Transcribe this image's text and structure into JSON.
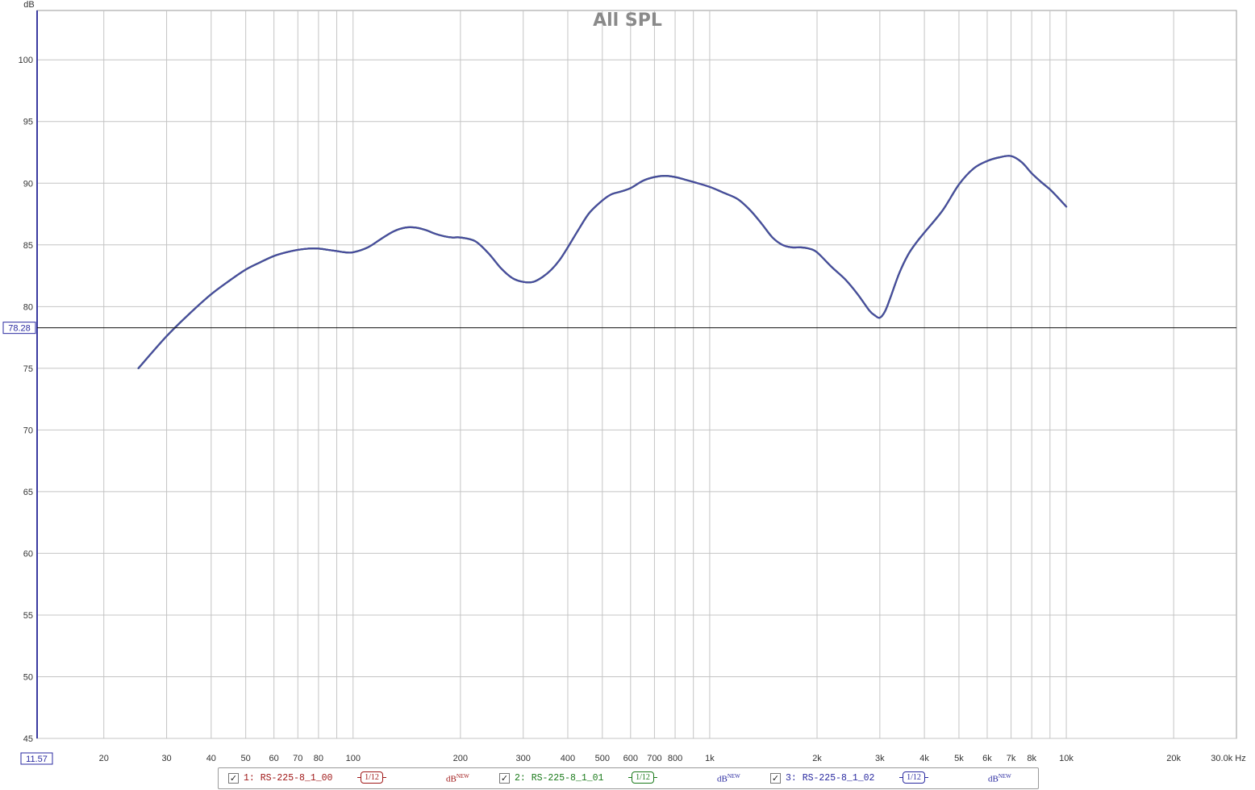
{
  "chart_data": {
    "type": "line",
    "title": "All SPL",
    "ylabel": "dB",
    "xunit": "Hz",
    "xscale": "log",
    "xlim": [
      13,
      30000
    ],
    "ylim": [
      45,
      104
    ],
    "grid": true,
    "x_ticks": [
      {
        "v": 20,
        "label": "20"
      },
      {
        "v": 30,
        "label": "30"
      },
      {
        "v": 40,
        "label": "40"
      },
      {
        "v": 50,
        "label": "50"
      },
      {
        "v": 60,
        "label": "60"
      },
      {
        "v": 70,
        "label": "70"
      },
      {
        "v": 80,
        "label": "80"
      },
      {
        "v": 100,
        "label": "100"
      },
      {
        "v": 200,
        "label": "200"
      },
      {
        "v": 300,
        "label": "300"
      },
      {
        "v": 400,
        "label": "400"
      },
      {
        "v": 500,
        "label": "500"
      },
      {
        "v": 600,
        "label": "600"
      },
      {
        "v": 700,
        "label": "700"
      },
      {
        "v": 800,
        "label": "800"
      },
      {
        "v": 1000,
        "label": "1k"
      },
      {
        "v": 2000,
        "label": "2k"
      },
      {
        "v": 3000,
        "label": "3k"
      },
      {
        "v": 4000,
        "label": "4k"
      },
      {
        "v": 5000,
        "label": "5k"
      },
      {
        "v": 6000,
        "label": "6k"
      },
      {
        "v": 7000,
        "label": "7k"
      },
      {
        "v": 8000,
        "label": "8k"
      },
      {
        "v": 10000,
        "label": "10k"
      },
      {
        "v": 20000,
        "label": "20k"
      },
      {
        "v": 30000,
        "label": "30.0k Hz"
      }
    ],
    "x_minor_grid": [
      90,
      900,
      9000
    ],
    "y_ticks": [
      45,
      50,
      55,
      60,
      65,
      70,
      75,
      80,
      85,
      90,
      95,
      100
    ],
    "cursor": {
      "y_value": "78.28",
      "x_value": "11.57"
    },
    "series": [
      {
        "name": "1: RS-225-8_1_00",
        "color": "#333377",
        "x": [
          25,
          30,
          35,
          40,
          45,
          50,
          55,
          60,
          65,
          70,
          75,
          80,
          85,
          90,
          95,
          100,
          110,
          120,
          130,
          140,
          150,
          160,
          170,
          180,
          190,
          200,
          220,
          240,
          260,
          280,
          300,
          320,
          340,
          360,
          380,
          400,
          430,
          460,
          500,
          530,
          560,
          600,
          650,
          700,
          750,
          800,
          850,
          900,
          1000,
          1100,
          1200,
          1300,
          1400,
          1500,
          1600,
          1700,
          1800,
          1900,
          2000,
          2200,
          2400,
          2600,
          2800,
          2900,
          3000,
          3100,
          3200,
          3400,
          3600,
          3800,
          4000,
          4500,
          5000,
          5500,
          6000,
          6500,
          7000,
          7500,
          8000,
          8500,
          9000,
          9500,
          10000
        ],
        "y": [
          75.0,
          77.6,
          79.5,
          81.0,
          82.1,
          83.0,
          83.6,
          84.1,
          84.4,
          84.6,
          84.7,
          84.7,
          84.6,
          84.5,
          84.4,
          84.4,
          84.8,
          85.5,
          86.1,
          86.4,
          86.4,
          86.2,
          85.9,
          85.7,
          85.6,
          85.6,
          85.3,
          84.3,
          83.1,
          82.3,
          82.0,
          82.0,
          82.4,
          83.0,
          83.8,
          84.8,
          86.3,
          87.6,
          88.6,
          89.1,
          89.3,
          89.6,
          90.2,
          90.5,
          90.6,
          90.5,
          90.3,
          90.1,
          89.7,
          89.2,
          88.7,
          87.8,
          86.7,
          85.6,
          85.0,
          84.8,
          84.8,
          84.7,
          84.4,
          83.2,
          82.2,
          81.0,
          79.7,
          79.3,
          79.1,
          79.6,
          80.6,
          82.7,
          84.2,
          85.2,
          86.0,
          87.8,
          89.9,
          91.2,
          91.8,
          92.1,
          92.2,
          91.7,
          90.8,
          90.1,
          89.5,
          88.8,
          88.1
        ]
      },
      {
        "name": "2: RS-225-8_1_01",
        "color": "#2a7a5a",
        "x": [
          25,
          30,
          35,
          40,
          45,
          50,
          55,
          60,
          65,
          70,
          75,
          80,
          85,
          90,
          95,
          100,
          110,
          120,
          130,
          140,
          150,
          160,
          170,
          180,
          190,
          200,
          220,
          240,
          260,
          280,
          300,
          320,
          340,
          360,
          380,
          400,
          430,
          460,
          500,
          530,
          560,
          600,
          650,
          700,
          750,
          800,
          850,
          900,
          1000,
          1100,
          1200,
          1300,
          1400,
          1500,
          1600,
          1700,
          1800,
          1900,
          2000,
          2200,
          2400,
          2600,
          2800,
          2900,
          3000,
          3100,
          3200,
          3400,
          3600,
          3800,
          4000,
          4500,
          5000,
          5500,
          6000,
          6500,
          7000,
          7500,
          8000,
          8500,
          9000,
          9500,
          10000
        ],
        "y": [
          75.0,
          77.6,
          79.5,
          81.0,
          82.1,
          83.0,
          83.6,
          84.1,
          84.4,
          84.6,
          84.7,
          84.7,
          84.6,
          84.5,
          84.4,
          84.4,
          84.8,
          85.5,
          86.1,
          86.4,
          86.4,
          86.2,
          85.9,
          85.7,
          85.6,
          85.6,
          85.3,
          84.3,
          83.1,
          82.3,
          82.0,
          82.0,
          82.4,
          83.0,
          83.8,
          84.8,
          86.3,
          87.6,
          88.6,
          89.1,
          89.3,
          89.6,
          90.2,
          90.5,
          90.6,
          90.5,
          90.3,
          90.1,
          89.7,
          89.2,
          88.7,
          87.8,
          86.7,
          85.6,
          85.0,
          84.8,
          84.8,
          84.7,
          84.4,
          83.2,
          82.2,
          81.0,
          79.7,
          79.3,
          79.1,
          79.6,
          80.6,
          82.7,
          84.2,
          85.2,
          86.0,
          87.8,
          89.9,
          91.2,
          91.8,
          92.1,
          92.2,
          91.7,
          90.8,
          90.1,
          89.5,
          88.8,
          88.1
        ]
      },
      {
        "name": "3: RS-225-8_1_02",
        "color": "#4a4aa0",
        "x": [
          25,
          30,
          35,
          40,
          45,
          50,
          55,
          60,
          65,
          70,
          75,
          80,
          85,
          90,
          95,
          100,
          110,
          120,
          130,
          140,
          150,
          160,
          170,
          180,
          190,
          200,
          220,
          240,
          260,
          280,
          300,
          320,
          340,
          360,
          380,
          400,
          430,
          460,
          500,
          530,
          560,
          600,
          650,
          700,
          750,
          800,
          850,
          900,
          1000,
          1100,
          1200,
          1300,
          1400,
          1500,
          1600,
          1700,
          1800,
          1900,
          2000,
          2200,
          2400,
          2600,
          2800,
          2900,
          3000,
          3100,
          3200,
          3400,
          3600,
          3800,
          4000,
          4500,
          5000,
          5500,
          6000,
          6500,
          7000,
          7500,
          8000,
          8500,
          9000,
          9500,
          10000
        ],
        "y": [
          75.0,
          77.6,
          79.5,
          81.0,
          82.1,
          83.0,
          83.6,
          84.1,
          84.4,
          84.6,
          84.7,
          84.7,
          84.6,
          84.5,
          84.4,
          84.4,
          84.8,
          85.5,
          86.1,
          86.4,
          86.4,
          86.2,
          85.9,
          85.7,
          85.6,
          85.6,
          85.3,
          84.3,
          83.1,
          82.3,
          82.0,
          82.0,
          82.4,
          83.0,
          83.8,
          84.8,
          86.3,
          87.6,
          88.6,
          89.1,
          89.3,
          89.6,
          90.2,
          90.5,
          90.6,
          90.5,
          90.3,
          90.1,
          89.7,
          89.2,
          88.7,
          87.8,
          86.7,
          85.6,
          85.0,
          84.8,
          84.8,
          84.7,
          84.4,
          83.2,
          82.2,
          81.0,
          79.7,
          79.3,
          79.1,
          79.6,
          80.6,
          82.7,
          84.2,
          85.2,
          86.0,
          87.8,
          89.9,
          91.2,
          91.8,
          92.1,
          92.2,
          91.7,
          90.8,
          90.1,
          89.5,
          88.8,
          88.1
        ]
      }
    ]
  },
  "legend": {
    "items": [
      {
        "checked": "✓",
        "name": "1: RS-225-8_1_00",
        "color": "#a01818",
        "smoothing": "1/12",
        "db": "dB",
        "db_sup": "NEW"
      },
      {
        "checked": "✓",
        "name": "2: RS-225-8_1_01",
        "color": "#1a7a1a",
        "smoothing": "1/12",
        "db": "dB",
        "db_sup": "NEW"
      },
      {
        "checked": "✓",
        "name": "3: RS-225-8_1_02",
        "color": "#2a2aa0",
        "smoothing": "1/12",
        "db": "dB",
        "db_sup": "NEW"
      }
    ]
  }
}
